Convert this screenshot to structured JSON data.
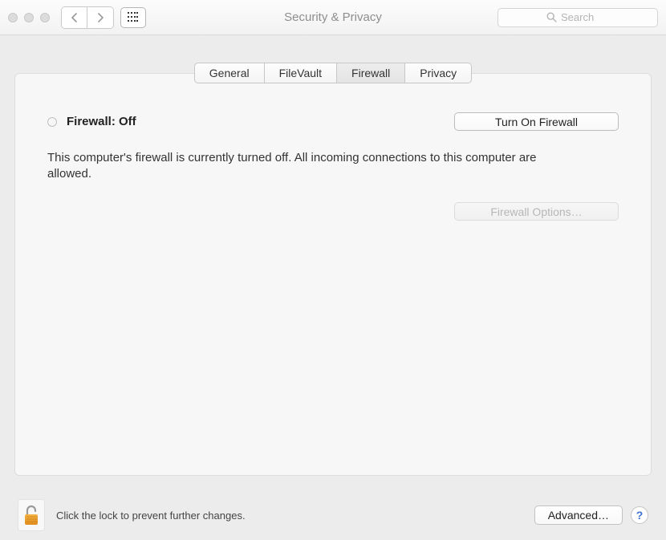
{
  "header": {
    "title": "Security & Privacy",
    "search_placeholder": "Search"
  },
  "tabs": [
    {
      "label": "General"
    },
    {
      "label": "FileVault"
    },
    {
      "label": "Firewall",
      "active": true
    },
    {
      "label": "Privacy"
    }
  ],
  "firewall": {
    "status_label": "Firewall: Off",
    "description": "This computer's firewall is currently turned off. All incoming connections to this computer are allowed.",
    "turn_on_label": "Turn On Firewall",
    "options_label": "Firewall Options…"
  },
  "footer": {
    "lock_label": "Click the lock to prevent further changes.",
    "advanced_label": "Advanced…",
    "help_label": "?"
  }
}
